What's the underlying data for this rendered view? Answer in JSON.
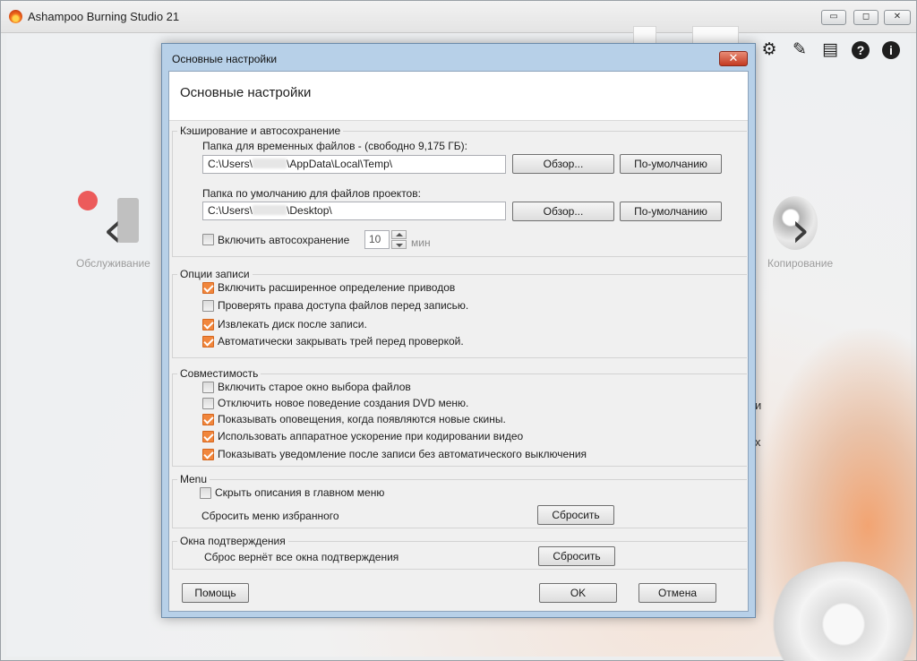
{
  "app": {
    "title": "Ashampoo Burning Studio 21",
    "min_glyph": "▭",
    "max_glyph": "◻",
    "close_glyph": "✕",
    "left_label": "Обслуживание",
    "right_label": "Копирование",
    "fragment_1": "и",
    "fragment_2": "х"
  },
  "dialog": {
    "title": "Основные настройки",
    "close_glyph": "✕",
    "page_title": "Основные настройки",
    "caching": {
      "legend": "Кэширование и автосохранение",
      "temp_label": "Папка для временных файлов - (свободно 9,175  ГБ):",
      "temp_path_prefix": "C:\\Users\\",
      "temp_path_suffix": "\\AppData\\Local\\Temp\\",
      "project_label": "Папка по умолчанию для файлов проектов:",
      "project_path_prefix": "C:\\Users\\",
      "project_path_suffix": "\\Desktop\\",
      "browse_label": "Обзор...",
      "default_label": "По-умолчанию",
      "autosave_label": "Включить автосохранение",
      "autosave_checked": false,
      "autosave_value": "10",
      "autosave_unit": "мин"
    },
    "burn_options": {
      "legend": "Опции записи",
      "items": [
        {
          "label": "Включить расширенное определение приводов",
          "checked": true
        },
        {
          "label": "Проверять права доступа файлов перед записью.",
          "checked": false
        },
        {
          "label": "Извлекать диск после записи.",
          "checked": true
        },
        {
          "label": "Автоматически закрывать трей перед проверкой.",
          "checked": true
        }
      ]
    },
    "compatibility": {
      "legend": "Совместимость",
      "items": [
        {
          "label": "Включить старое окно выбора файлов",
          "checked": false
        },
        {
          "label": "Отключить новое поведение создания DVD меню.",
          "checked": false
        },
        {
          "label": "Показывать оповещения, когда появляются новые скины.",
          "checked": true
        },
        {
          "label": "Использовать аппаратное ускорение при кодировании видео",
          "checked": true
        },
        {
          "label": "Показывать уведомление после записи без автоматического выключения",
          "checked": true
        }
      ]
    },
    "menu": {
      "legend": "Menu",
      "hide_desc_label": "Скрыть описания в главном меню",
      "hide_desc_checked": false,
      "reset_fav_label": "Сбросить меню избранного",
      "reset_button": "Сбросить"
    },
    "confirm": {
      "legend": "Окна подтверждения",
      "reset_text": "Сброс вернёт все окна подтверждения",
      "reset_button": "Сбросить"
    },
    "footer": {
      "help": "Помощь",
      "ok": "OK",
      "cancel": "Отмена"
    }
  },
  "toolbar_icons": [
    "gear-icon",
    "brush-icon",
    "chat-icon",
    "help-icon",
    "info-icon"
  ],
  "colors": {
    "checkbox_checked": "#f1863c",
    "dialog_frame": "#b7d0e8",
    "close_button": "#c43b22"
  }
}
